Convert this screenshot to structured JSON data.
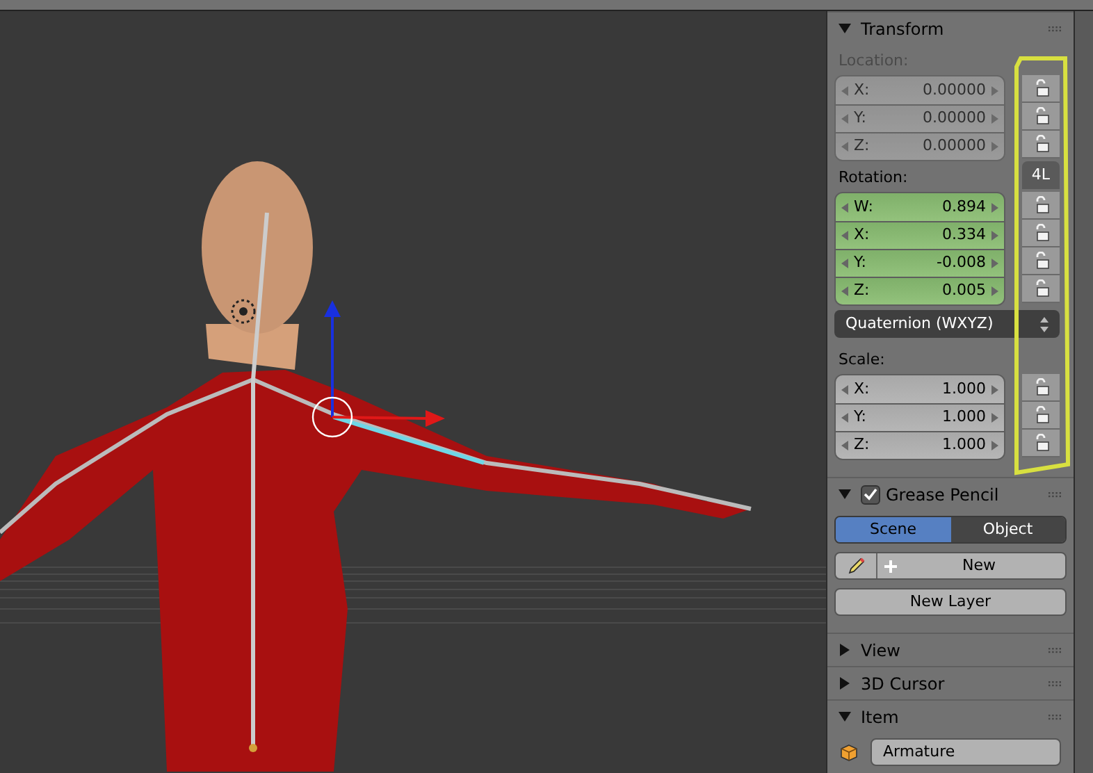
{
  "transform": {
    "title": "Transform",
    "expanded": true,
    "location": {
      "label": "Location:",
      "kind": "plain",
      "disabled": true,
      "fields": [
        {
          "axis": "X:",
          "value": "0.00000",
          "locked": false
        },
        {
          "axis": "Y:",
          "value": "0.00000",
          "locked": false
        },
        {
          "axis": "Z:",
          "value": "0.00000",
          "locked": false
        }
      ]
    },
    "rotation": {
      "label": "Rotation:",
      "kind": "keyframed",
      "disabled": false,
      "lock_mode": "4L",
      "fields": [
        {
          "axis": "W:",
          "value": "0.894",
          "locked": false
        },
        {
          "axis": "X:",
          "value": "0.334",
          "locked": false
        },
        {
          "axis": "Y:",
          "value": "-0.008",
          "locked": false
        },
        {
          "axis": "Z:",
          "value": "0.005",
          "locked": false
        }
      ]
    },
    "rotation_mode": "Quaternion (WXYZ)",
    "scale": {
      "label": "Scale:",
      "kind": "plain",
      "disabled": false,
      "fields": [
        {
          "axis": "X:",
          "value": "1.000",
          "locked": false
        },
        {
          "axis": "Y:",
          "value": "1.000",
          "locked": false
        },
        {
          "axis": "Z:",
          "value": "1.000",
          "locked": false
        }
      ]
    }
  },
  "grease_pencil": {
    "title": "Grease Pencil",
    "expanded": true,
    "checked": true,
    "tabs": [
      {
        "label": "Scene",
        "selected": true
      },
      {
        "label": "Object",
        "selected": false
      }
    ],
    "new_button": "New",
    "new_layer_button": "New Layer"
  },
  "panels": [
    {
      "title": "View",
      "expanded": false
    },
    {
      "title": "3D Cursor",
      "expanded": false
    },
    {
      "title": "Item",
      "expanded": true
    }
  ],
  "item": {
    "name": "Armature"
  }
}
